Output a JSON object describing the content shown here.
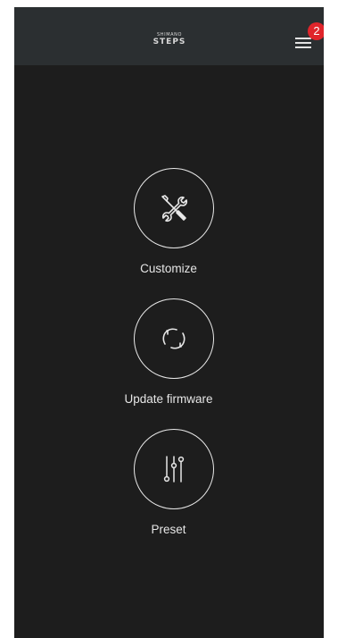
{
  "header": {
    "logo_top": "SHIMANO",
    "logo_bottom": "STEPS",
    "menu_icon": "hamburger-menu-icon",
    "notification_count": "2",
    "badge_color": "#e0252b"
  },
  "menu": {
    "items": [
      {
        "label": "Customize",
        "icon": "wrench-screwdriver-icon"
      },
      {
        "label": "Update firmware",
        "icon": "refresh-arrows-icon"
      },
      {
        "label": "Preset",
        "icon": "sliders-icon"
      }
    ]
  },
  "colors": {
    "background": "#1d1d1d",
    "appbar": "#2b2f31",
    "foreground": "#e6e6e6"
  }
}
